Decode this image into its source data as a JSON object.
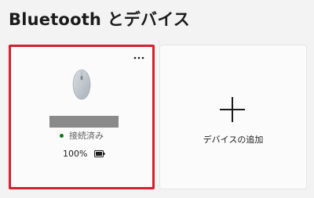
{
  "page": {
    "title": "Bluetooth とデバイス"
  },
  "device_card": {
    "icon": "mouse-icon",
    "status": "接続済み",
    "status_color": "#0f7b0f",
    "battery_percent": "100%",
    "more_icon": "more-horizontal-icon",
    "highlight_color": "#d4202f"
  },
  "add_card": {
    "icon": "plus-icon",
    "label": "デバイスの追加"
  }
}
